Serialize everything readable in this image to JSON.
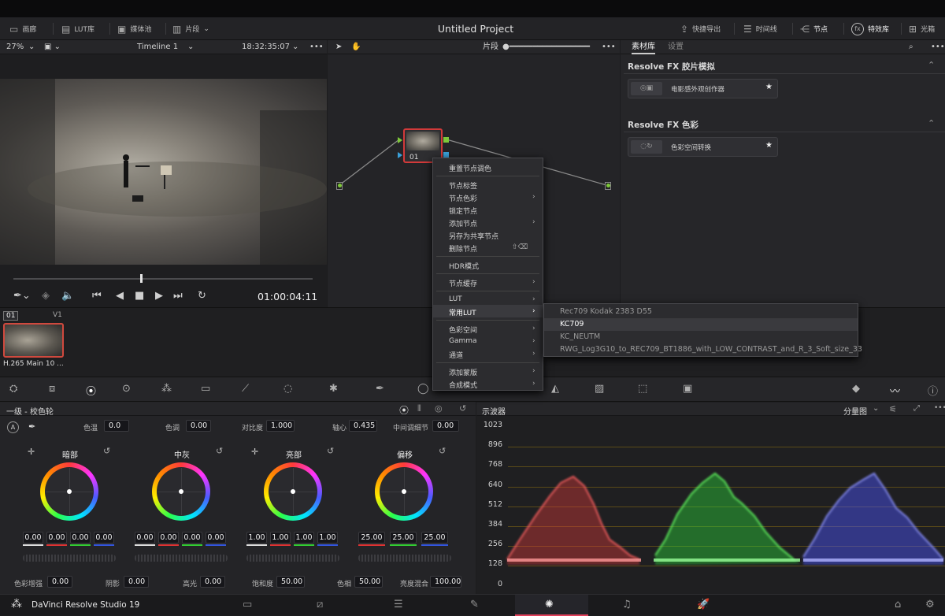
{
  "app": {
    "project_title": "Untitled Project",
    "brand": "DaVinci Resolve Studio 19"
  },
  "menu": {
    "left": [
      "画廊",
      "LUT库",
      "媒体池",
      "片段"
    ],
    "right": [
      "快捷导出",
      "时间线",
      "节点",
      "特效库",
      "光箱"
    ]
  },
  "viewer": {
    "zoom": "27%",
    "timeline": "Timeline 1",
    "timecode_top": "18:32:35:07",
    "timecode": "01:00:04:11"
  },
  "nodes": {
    "mode": "片段",
    "node_label": "01"
  },
  "library": {
    "tabs": [
      "素材库",
      "设置"
    ],
    "sections": [
      {
        "title": "Resolve FX 胶片模拟",
        "item": "电影感外观创作器"
      },
      {
        "title": "Resolve FX 色彩",
        "item": "色彩空间转换"
      }
    ]
  },
  "clip": {
    "num": "01",
    "track": "V1",
    "name": "H.265 Main 10 ..."
  },
  "context_menu": {
    "items": [
      "重置节点调色",
      "节点标签",
      "节点色彩",
      "锁定节点",
      "添加节点",
      "另存为共享节点",
      "删除节点",
      "HDR模式",
      "节点缓存",
      "LUT",
      "常用LUT",
      "色彩空间",
      "Gamma",
      "通道",
      "添加蒙版",
      "合成模式"
    ],
    "delete_shortcut": "⇧⌫"
  },
  "lut_submenu": {
    "items": [
      "Rec709 Kodak 2383 D55",
      "KC709",
      "KC_NEUTM",
      "RWG_Log3G10_to_REC709_BT1886_with_LOW_CONTRAST_and_R_3_Soft_size_33"
    ],
    "selected": 1
  },
  "color": {
    "title": "一级 - 校色轮",
    "top": {
      "temp_label": "色温",
      "temp": "0.0",
      "tint_label": "色调",
      "tint": "0.00",
      "contrast_label": "对比度",
      "contrast": "1.000",
      "pivot_label": "轴心",
      "pivot": "0.435",
      "middetail_label": "中间调细节",
      "middetail": "0.00"
    },
    "wheels": [
      {
        "name": "暗部",
        "values": [
          "0.00",
          "0.00",
          "0.00",
          "0.00"
        ]
      },
      {
        "name": "中灰",
        "values": [
          "0.00",
          "0.00",
          "0.00",
          "0.00"
        ]
      },
      {
        "name": "亮部",
        "values": [
          "1.00",
          "1.00",
          "1.00",
          "1.00"
        ]
      },
      {
        "name": "偏移",
        "values": [
          "25.00",
          "25.00",
          "25.00"
        ]
      }
    ],
    "bottom": {
      "boost_label": "色彩增强",
      "boost": "0.00",
      "shadow_label": "阴影",
      "shadow": "0.00",
      "hl_label": "高光",
      "hl": "0.00",
      "sat_label": "饱和度",
      "sat": "50.00",
      "hue_label": "色相",
      "hue": "50.00",
      "lummix_label": "亮度混合",
      "lummix": "100.00"
    }
  },
  "scope": {
    "title": "示波器",
    "mode": "分量图",
    "ticks": [
      "1023",
      "896",
      "768",
      "640",
      "512",
      "384",
      "256",
      "128",
      "0"
    ]
  },
  "colors": {
    "accent_red": "#d23a3a",
    "active_page": "#e0405a"
  }
}
